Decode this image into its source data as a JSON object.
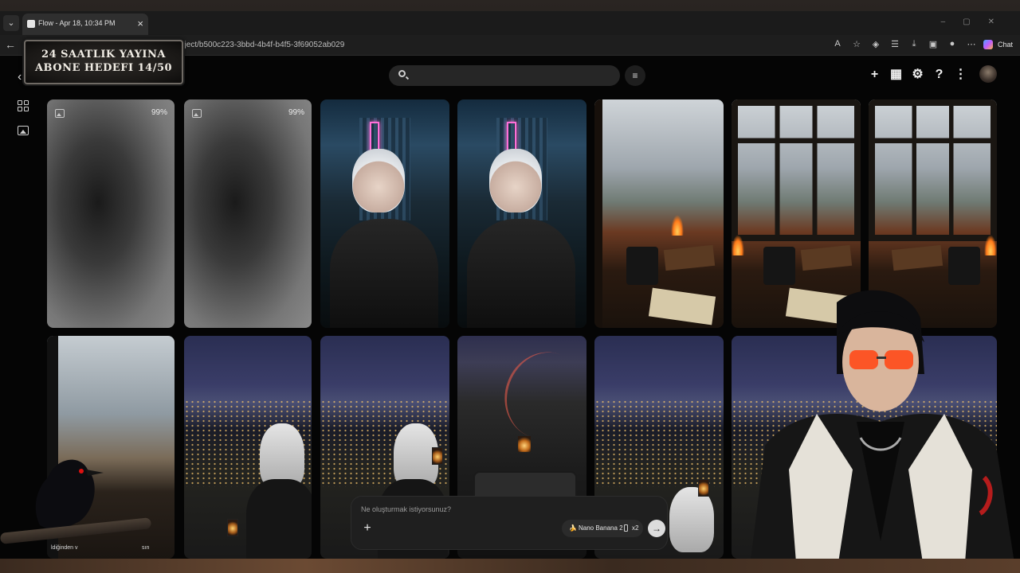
{
  "browser": {
    "tab_title": "Flow - Apr 18, 10:34 PM",
    "url": "oject/b500c223-3bbd-4b4f-b4f5-3f69052ab029",
    "chat_label": "Chat"
  },
  "banner": {
    "line1": "24 Saatlik Yayina",
    "line2": "Abone Hedefi 14/50"
  },
  "grid": {
    "row1": [
      {
        "kind": "loading",
        "progress": "99%"
      },
      {
        "kind": "loading",
        "progress": "99%"
      },
      {
        "kind": "image",
        "subject": "short-haired person in leather jacket, neon alley"
      },
      {
        "kind": "image",
        "subject": "bob-haired person in leather jacket, neon alley"
      },
      {
        "kind": "image",
        "subject": "rainy window with mug and book"
      },
      {
        "kind": "image",
        "subject": "window with mug, book, fireplace"
      },
      {
        "kind": "image",
        "subject": "window with mug, book, fireplace"
      }
    ],
    "row2": [
      {
        "kind": "image",
        "subject": "open window overlooking mountains"
      },
      {
        "kind": "image",
        "subject": "person on balcony over night city"
      },
      {
        "kind": "image",
        "subject": "person on balcony over night city"
      },
      {
        "kind": "image",
        "subject": "top-down table on balcony, night city"
      },
      {
        "kind": "image",
        "subject": "person on balcony over night city"
      },
      {
        "kind": "image",
        "subject": "night city panorama"
      }
    ]
  },
  "composer": {
    "placeholder": "Ne oluşturmak istiyorsunuz?",
    "model_emoji": "🍌",
    "model_label": "Nano Banana 2",
    "count_label": "x2"
  },
  "overlay_text": {
    "left_fragment": "ldiğinden v",
    "right_fragment": "sın"
  },
  "icons": {
    "tab_menu": "chevron-down-icon",
    "back": "arrow-left-icon",
    "search": "search-icon",
    "filter": "filter-icon",
    "add": "plus-icon",
    "film": "film-icon",
    "settings": "gear-icon",
    "help": "help-icon",
    "more": "kebab-icon"
  }
}
